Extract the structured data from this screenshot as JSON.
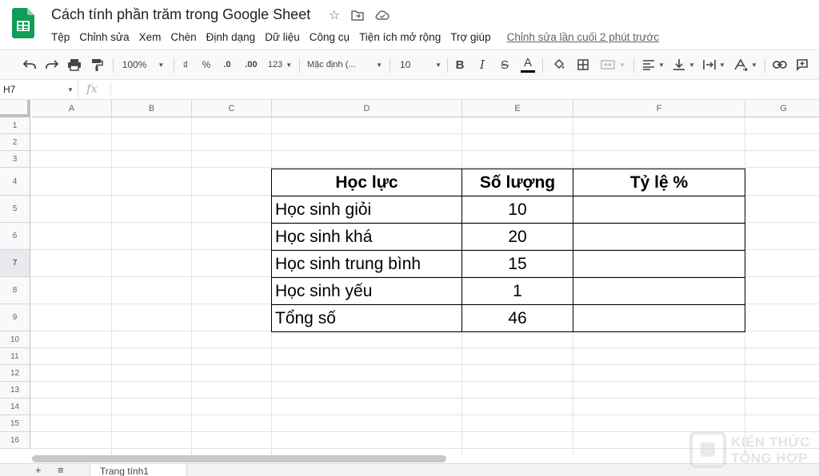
{
  "app": {
    "doc_title": "Cách tính phần trăm trong Google Sheet"
  },
  "menu": {
    "items": [
      "Tệp",
      "Chỉnh sửa",
      "Xem",
      "Chèn",
      "Định dạng",
      "Dữ liệu",
      "Công cụ",
      "Tiện ích mở rộng",
      "Trợ giúp"
    ],
    "last_edit": "Chỉnh sửa lần cuối 2 phút trước"
  },
  "toolbar": {
    "zoom": "100%",
    "currency": "₫",
    "percent": "%",
    "decimal_decrease": ".0",
    "decimal_increase": ".00",
    "more_formats": "123",
    "font": "Mặc định (...",
    "font_size": "10",
    "bold": "B",
    "italic": "I",
    "strike": "S",
    "text_color": "A"
  },
  "formula_bar": {
    "name_box": "H7",
    "fx": "fx"
  },
  "grid": {
    "columns": [
      "A",
      "B",
      "C",
      "D",
      "E",
      "F",
      "G"
    ],
    "rows": [
      "1",
      "2",
      "3",
      "4",
      "5",
      "6",
      "7",
      "8",
      "9",
      "10",
      "11",
      "12",
      "13",
      "14",
      "15",
      "16"
    ],
    "selected_row": "7"
  },
  "table": {
    "headers": [
      "Học lực",
      "Số lượng",
      "Tỷ lệ %"
    ],
    "rows": [
      {
        "label": "Học sinh giỏi",
        "count": "10",
        "ratio": ""
      },
      {
        "label": "Học sinh khá",
        "count": "20",
        "ratio": ""
      },
      {
        "label": "Học sinh trung bình",
        "count": "15",
        "ratio": ""
      },
      {
        "label": "Học sinh yếu",
        "count": "1",
        "ratio": ""
      },
      {
        "label": "Tổng số",
        "count": "46",
        "ratio": ""
      }
    ]
  },
  "bottom": {
    "add_sheet": "+",
    "all_sheets": "≡",
    "sheet_tab": "Trang tính1"
  },
  "watermark": {
    "line1": "KIẾN THỨC",
    "line2": "TỔNG HỢP"
  },
  "colors": {
    "sheets_green": "#0f9d58",
    "toolbar_bg": "#f8f9fa",
    "grid_line": "#e2e2e2"
  }
}
